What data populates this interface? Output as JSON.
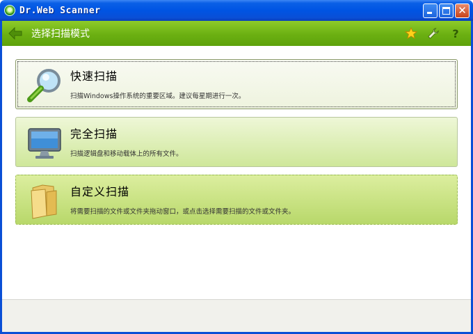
{
  "window": {
    "title": "Dr.Web Scanner"
  },
  "header": {
    "title": "选择扫描模式"
  },
  "options": [
    {
      "title": "快速扫描",
      "description": "扫描Windows操作系统的重要区域。建议每星期进行一次。",
      "icon": "magnifier-icon"
    },
    {
      "title": "完全扫描",
      "description": "扫描逻辑盘和移动载体上的所有文件。",
      "icon": "monitor-icon"
    },
    {
      "title": "自定义扫描",
      "description": "将需要扫描的文件或文件夹拖动窗口，或点击选择需要扫描的文件或文件夹。",
      "icon": "folder-icon"
    }
  ],
  "colors": {
    "titlebar": "#0054e3",
    "header": "#6bb012",
    "accent_green": "#7cbf1c"
  }
}
